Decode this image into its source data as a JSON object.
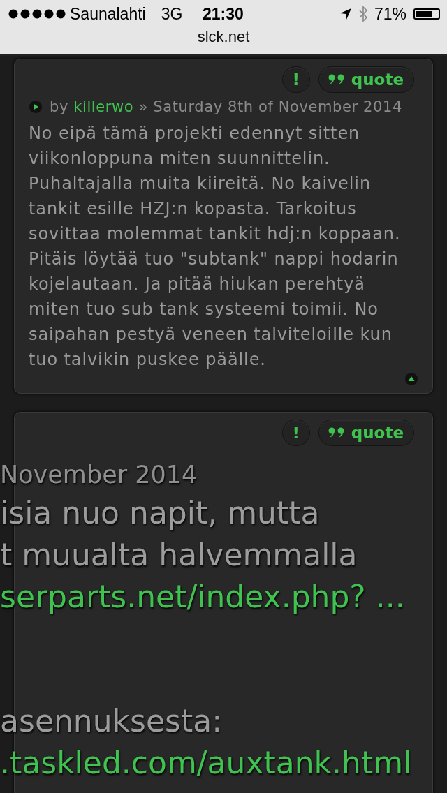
{
  "status_bar": {
    "carrier": "Saunalahti",
    "network": "3G",
    "time": "21:30",
    "battery": "71%"
  },
  "address_bar": {
    "url": "slck.net"
  },
  "posts": [
    {
      "buttons": {
        "report": "!",
        "quote": "quote"
      },
      "byline": {
        "by": "by",
        "author": "killerwo",
        "separator": "»",
        "date": "Saturday 8th of November 2014"
      },
      "body": "No eipä tämä projekti edennyt sitten viikonloppuna miten suunnittelin. Puhaltajalla muita kiireitä. No kaivelin tankit esille HZJ:n kopasta. Tarkoitus sovittaa molemmat tankit hdj:n koppaan. Pitäis löytää tuo \"subtank\" nappi hodarin kojelautaan. Ja pitää hiukan perehtyä miten tuo sub tank systeemi toimii. No saipahan pestyä veneen talviteloille kun tuo talvikin puskee päälle."
    },
    {
      "buttons": {
        "report": "!",
        "quote": "quote"
      }
    }
  ],
  "zoomed_overlay": [
    [
      {
        "kind": "date",
        "text": "November 2014"
      },
      {
        "kind": "text",
        "text": "isia nuo napit, mutta"
      },
      {
        "kind": "text",
        "text": "t muualta halvemmalla"
      },
      {
        "kind": "link",
        "text": "serparts.net/index.php? ..."
      }
    ],
    [
      {
        "kind": "text",
        "text": "asennuksesta:"
      },
      {
        "kind": "link",
        "text": ".taskled.com/auxtank.html"
      }
    ]
  ]
}
